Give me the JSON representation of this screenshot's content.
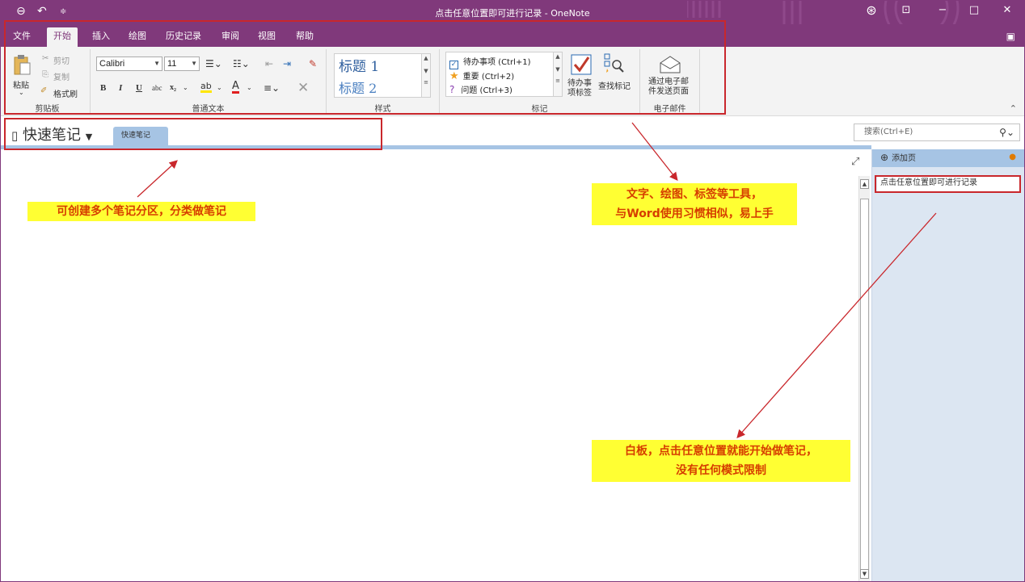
{
  "window": {
    "title": "点击任意位置即可进行记录 - OneNote"
  },
  "ribbon_tabs": [
    "文件",
    "开始",
    "插入",
    "绘图",
    "历史记录",
    "审阅",
    "视图",
    "帮助"
  ],
  "clipboard": {
    "paste": "粘贴",
    "cut": "剪切",
    "copy": "复制",
    "format_painter": "格式刷",
    "group_label": "剪贴板"
  },
  "basic_text": {
    "font": "Calibri",
    "size": "11",
    "bold": "B",
    "italic": "I",
    "underline": "U",
    "strike": "abc",
    "subscript": "x₂",
    "group_label": "普通文本"
  },
  "styles": {
    "heading1": "标题 1",
    "heading2": "标题 2",
    "group_label": "样式"
  },
  "tags": {
    "todo": "待办事项 (Ctrl+1)",
    "important": "重要 (Ctrl+2)",
    "question": "问题 (Ctrl+3)",
    "todo_tag_btn": "待办事\n项标签",
    "find_tags": "查找标记",
    "group_label": "标记"
  },
  "email": {
    "send_page": "通过电子邮\n件发送页面",
    "group_label": "电子邮件"
  },
  "notebook": {
    "name": "快速笔记",
    "section_tab": "快速笔记"
  },
  "search": {
    "placeholder": "搜索(Ctrl+E)"
  },
  "pages_panel": {
    "add_page": "添加页",
    "page_title": "点击任意位置即可进行记录"
  },
  "annotations": {
    "sections": "可创建多个笔记分区，分类做笔记",
    "tools_line1": "文字、绘图、标签等工具，",
    "tools_line2": "与Word使用习惯相似，易上手",
    "canvas_line1": "白板，点击任意位置就能开始做笔记，",
    "canvas_line2": "没有任何模式限制"
  },
  "colors": {
    "onenote_purple": "#80397b",
    "section_blue": "#a6c4e4",
    "annotation_red": "#c9272c",
    "highlight_yellow": "#ffff33"
  }
}
